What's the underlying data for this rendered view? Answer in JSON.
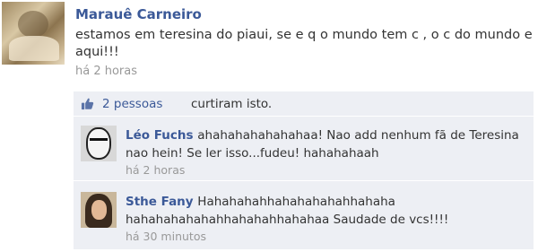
{
  "post": {
    "author": "Marauê Carneiro",
    "text": "estamos em teresina do piaui, se e q o mundo tem c , o c do mundo e aqui!!!",
    "time": "há 2 horas"
  },
  "likes": {
    "link_text": "2 pessoas",
    "suffix": "curtiram isto.",
    "icon": "thumbs-up-icon",
    "accent_color": "#3b5998"
  },
  "comments": [
    {
      "author": "Léo Fuchs",
      "text": "ahahahahahahahaa! Nao add nenhum fã de Teresina nao hein! Se ler isso...fudeu! hahahahaah",
      "time": "há 2 horas"
    },
    {
      "author": "Sthe Fany",
      "text": "Hahahahahhahahahahahhahaha hahahahahahahhahahahhahahaa Saudade de vcs!!!!",
      "time": "há 30 minutos"
    }
  ]
}
